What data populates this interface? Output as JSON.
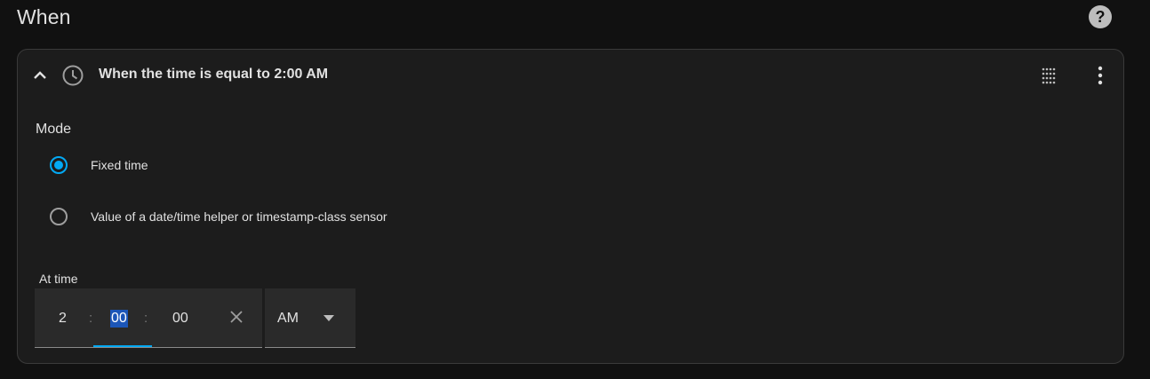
{
  "section": {
    "title": "When",
    "help_icon": "help-circle-icon",
    "help_glyph": "?"
  },
  "trigger": {
    "title": "When the time is equal to 2:00 AM",
    "icons": {
      "collapse": "chevron-up-icon",
      "type": "clock-icon",
      "drag": "drag-handle-icon",
      "menu": "dots-vertical-icon"
    },
    "mode": {
      "label": "Mode",
      "options": [
        {
          "label": "Fixed time",
          "checked": true
        },
        {
          "label": "Value of a date/time helper or timestamp-class sensor",
          "checked": false
        }
      ]
    },
    "at_time": {
      "label": "At time",
      "hours": "2",
      "minutes": "00",
      "seconds": "00",
      "separator": ":",
      "clear_icon": "close-icon",
      "period": {
        "value": "AM",
        "icon": "arrow-drop-down-icon"
      }
    }
  },
  "colors": {
    "accent": "#03a9f4",
    "selection": "#1c56b8",
    "card_background": "#1c1c1c",
    "page_background": "#111111"
  }
}
